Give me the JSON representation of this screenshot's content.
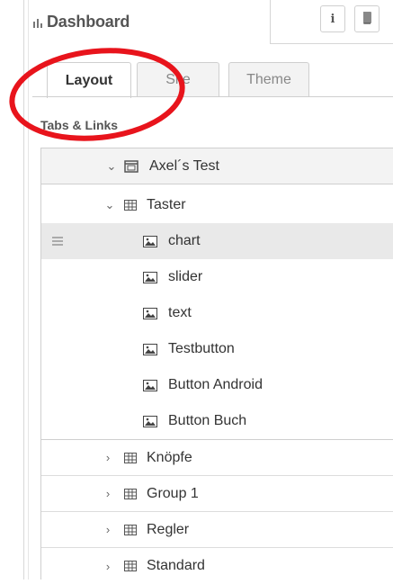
{
  "header": {
    "title": "Dashboard",
    "icon": "bar-chart-icon"
  },
  "toolbar": {
    "info_icon": "i",
    "book_icon": "book-icon"
  },
  "tabs": [
    {
      "label": "Layout",
      "active": true
    },
    {
      "label": "Site",
      "active": false
    },
    {
      "label": "Theme",
      "active": false
    }
  ],
  "section_label": "Tabs & Links",
  "tree": {
    "tab": {
      "label": "Axel´s Test",
      "expanded": true
    },
    "groups": [
      {
        "label": "Taster",
        "expanded": true,
        "widgets": [
          "chart",
          "slider",
          "text",
          "Testbutton",
          "Button Android",
          "Button Buch"
        ]
      },
      {
        "label": "Knöpfe",
        "expanded": false
      },
      {
        "label": "Group 1",
        "expanded": false
      },
      {
        "label": "Regler",
        "expanded": false
      },
      {
        "label": "Standard",
        "expanded": false
      }
    ],
    "selected_widget": "chart"
  },
  "annotation": {
    "color": "#e8141c"
  }
}
